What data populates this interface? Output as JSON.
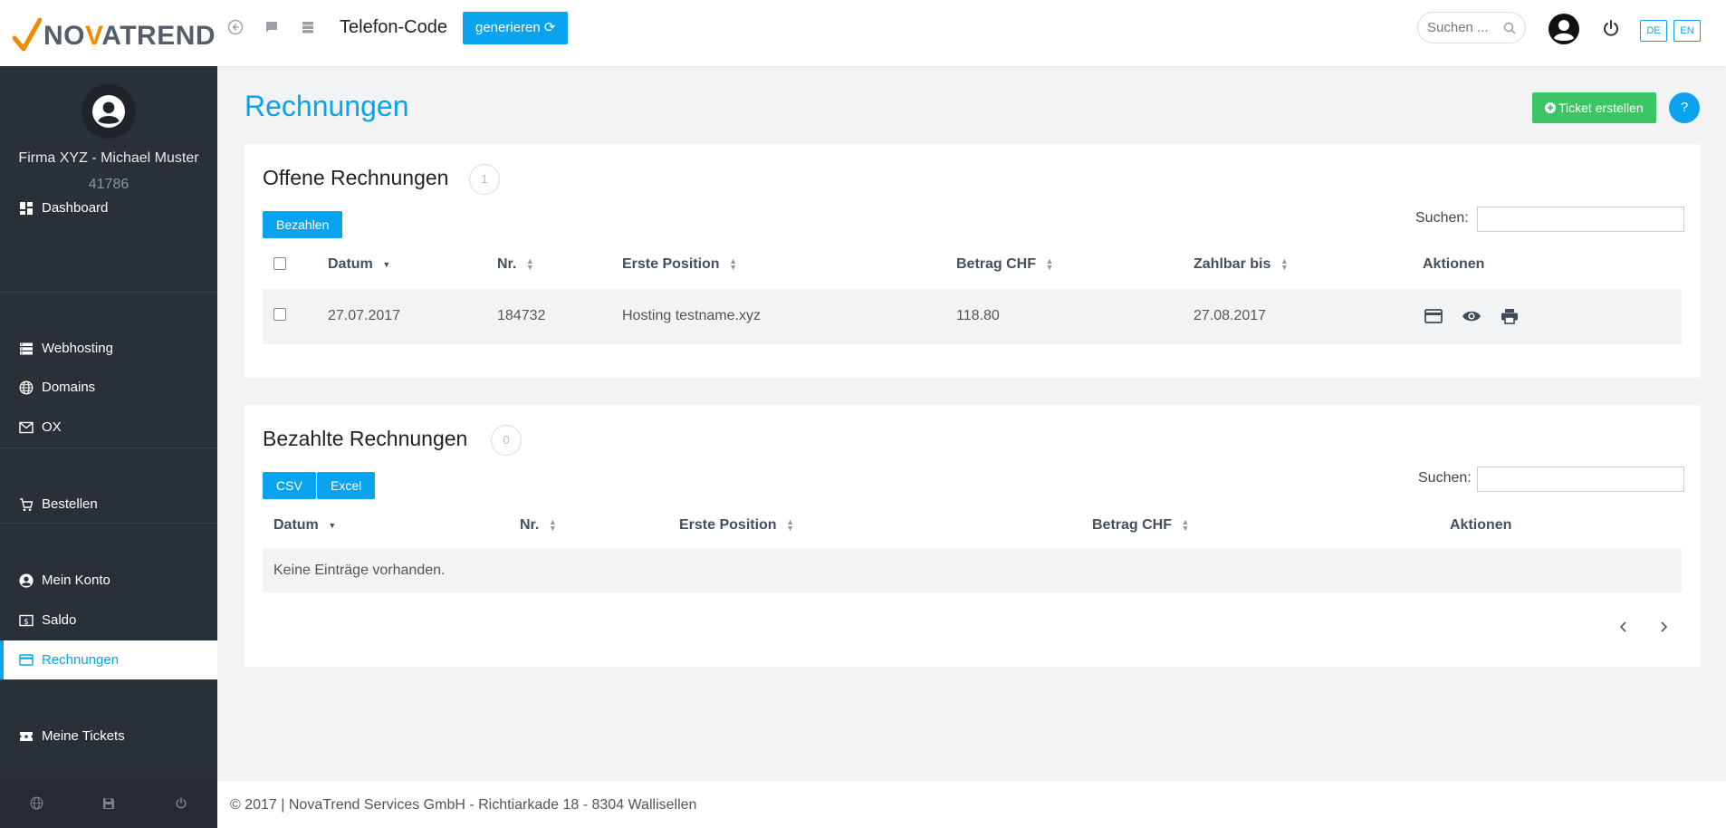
{
  "header": {
    "logo": {
      "pre": "NO",
      "v": "V",
      "post": "ATREND"
    },
    "icons": [
      "back-circle-icon",
      "chat-icon",
      "server-icon"
    ],
    "title": "Telefon-Code",
    "generate_label": "generieren ⟳",
    "search_placeholder": "Suchen ...",
    "lang_de": "DE",
    "lang_en": "EN"
  },
  "sidebar": {
    "user_name": "Firma XYZ - Michael Muster",
    "user_id": "41786",
    "items": {
      "dashboard": "Dashboard",
      "webhosting": "Webhosting",
      "domains": "Domains",
      "ox": "OX",
      "bestellen": "Bestellen",
      "mein_konto": "Mein Konto",
      "saldo": "Saldo",
      "rechnungen": "Rechnungen",
      "meine_tickets": "Meine Tickets"
    }
  },
  "main": {
    "title": "Rechnungen",
    "ticket_button": "Ticket erstellen",
    "help_button": "?"
  },
  "open_invoices": {
    "title": "Offene Rechnungen",
    "count": "1",
    "pay_button": "Bezahlen",
    "search_label": "Suchen:",
    "columns": {
      "datum": "Datum",
      "nr": "Nr.",
      "erste_position": "Erste Position",
      "betrag": "Betrag CHF",
      "zahlbar_bis": "Zahlbar bis",
      "aktionen": "Aktionen"
    },
    "rows": [
      {
        "datum": "27.07.2017",
        "nr": "184732",
        "position": "Hosting testname.xyz",
        "betrag": "118.80",
        "zahlbar_bis": "27.08.2017"
      }
    ]
  },
  "paid_invoices": {
    "title": "Bezahlte Rechnungen",
    "count": "0",
    "csv_button": "CSV",
    "excel_button": "Excel",
    "search_label": "Suchen:",
    "columns": {
      "datum": "Datum",
      "nr": "Nr.",
      "erste_position": "Erste Position",
      "betrag": "Betrag CHF",
      "aktionen": "Aktionen"
    },
    "empty_text": "Keine Einträge vorhanden."
  },
  "footer": {
    "text": "© 2017 | NovaTrend Services GmbH - Richtiarkade 18 - 8304 Wallisellen"
  },
  "colors": {
    "accent": "#0aa3f0",
    "success": "#3cc565",
    "sidebar_bg": "#2a3038",
    "logo_orange": "#f08a00"
  }
}
